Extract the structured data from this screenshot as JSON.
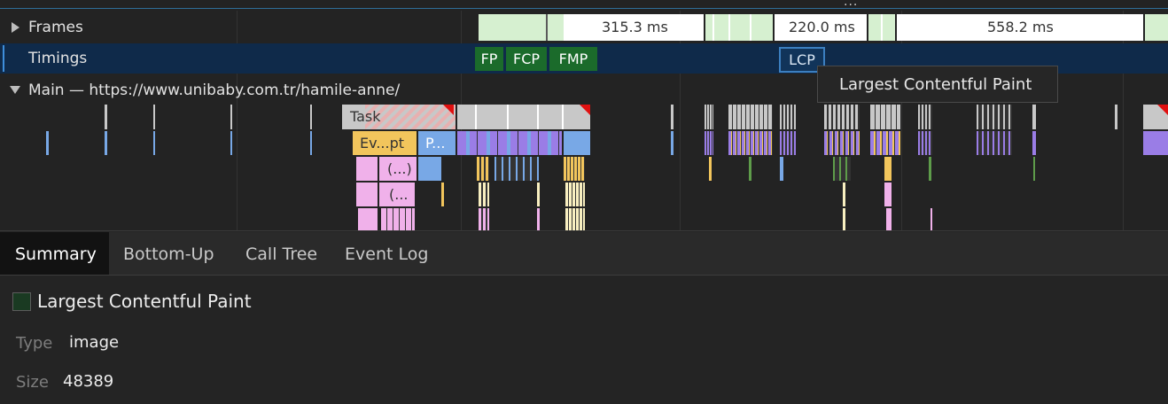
{
  "tracks": {
    "frames_label": "Frames",
    "timings_label": "Timings",
    "main_label": "Main — https://www.unibaby.com.tr/hamile-anne/"
  },
  "frames": {
    "durations": [
      "315.3 ms",
      "220.0 ms",
      "558.2 ms"
    ]
  },
  "timing_markers": [
    "FP",
    "FCP",
    "FMP",
    "LCP"
  ],
  "tooltip": "Largest Contentful Paint",
  "flame": {
    "task_label": "Task",
    "event_label": "Ev...pt",
    "parse_label": "P...",
    "anon_label_1": "(...)",
    "anon_label_2": "(..."
  },
  "tabs": [
    "Summary",
    "Bottom-Up",
    "Call Tree",
    "Event Log"
  ],
  "summary": {
    "title": "Largest Contentful Paint",
    "type_key": "Type",
    "type_value": "image",
    "size_key": "Size",
    "size_value": "48389"
  },
  "colors": {
    "timing_marker_green": "#1b6b2b",
    "lcp_marker": "#11345a",
    "task_gray": "#c8c8c8",
    "event_yellow": "#f2c55c",
    "parse_blue": "#78a8e6",
    "script_pink": "#f0b1ea",
    "layout_purple": "#9a7de6",
    "frame_green": "#d6f0d0"
  }
}
